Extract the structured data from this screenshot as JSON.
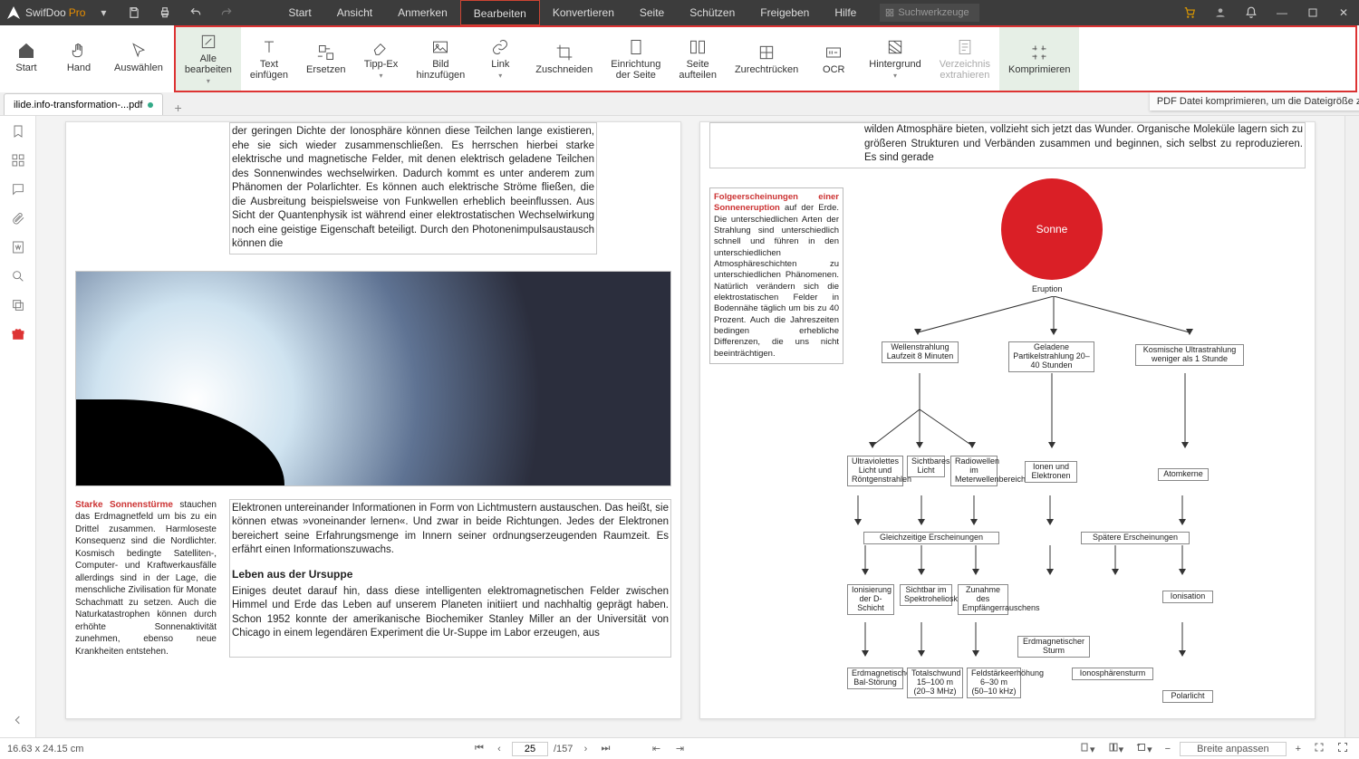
{
  "titlebar": {
    "appname": "SwifDoo",
    "pro": "Pro",
    "menus": [
      "Start",
      "Ansicht",
      "Anmerken",
      "Bearbeiten",
      "Konvertieren",
      "Seite",
      "Schützen",
      "Freigeben",
      "Hilfe"
    ],
    "active_menu_index": 3,
    "search_placeholder": "Suchwerkzeuge"
  },
  "ribbon": {
    "outside": [
      {
        "key": "start",
        "label1": "Start"
      },
      {
        "key": "hand",
        "label1": "Hand"
      },
      {
        "key": "select",
        "label1": "Auswählen"
      }
    ],
    "tools": [
      {
        "key": "editall",
        "label1": "Alle",
        "label2": "bearbeiten",
        "dd": true,
        "highlight": true
      },
      {
        "key": "inserttext",
        "label1": "Text",
        "label2": "einfügen"
      },
      {
        "key": "replace",
        "label1": "Ersetzen"
      },
      {
        "key": "tippex",
        "label1": "Tipp-Ex",
        "dd": true
      },
      {
        "key": "addimage",
        "label1": "Bild",
        "label2": "hinzufügen"
      },
      {
        "key": "link",
        "label1": "Link",
        "dd": true
      },
      {
        "key": "crop",
        "label1": "Zuschneiden"
      },
      {
        "key": "pagesetup",
        "label1": "Einrichtung",
        "label2": "der Seite"
      },
      {
        "key": "split",
        "label1": "Seite",
        "label2": "aufteilen"
      },
      {
        "key": "flatten",
        "label1": "Zurechtrücken"
      },
      {
        "key": "ocr",
        "label1": "OCR"
      },
      {
        "key": "background",
        "label1": "Hintergrund",
        "dd": true
      },
      {
        "key": "extract",
        "label1": "Verzeichnis",
        "label2": "extrahieren",
        "disabled": true
      },
      {
        "key": "compress",
        "label1": "Komprimieren",
        "highlight": true
      }
    ],
    "tooltip": "PDF Datei komprimieren, um die Dateigröße zu optimieren"
  },
  "tab": {
    "filename": "ilide.info-transformation-...pdf",
    "page_badge": "1"
  },
  "document": {
    "pageA": {
      "topText": "der geringen Dichte der Ionosphäre können diese Teilchen lange existieren, ehe sie sich wieder zusammenschließen. Es herrschen hierbei starke elektrische und magnetische Felder, mit denen elektrisch geladene Teilchen des Sonnenwindes wechselwirken. Dadurch kommt es unter anderem zum Phänomen der Polarlichter. Es können auch elektrische Ströme fließen, die die Ausbreitung beispielsweise von Funkwellen erheblich beeinflussen. Aus Sicht der Quantenphysik ist während einer elektrostatischen Wechselwirkung noch eine geistige Eigenschaft beteiligt. Durch den Photonenimpulsaustausch können die",
      "sideTitle": "Starke Sonnenstürme",
      "sideText": " stauchen das Erdmagnetfeld um bis zu ein Drittel zusammen. Harmloseste Konsequenz sind die Nordlichter. Kosmisch bedingte Satelliten-, Computer- und Kraftwerkausfälle allerdings sind in der Lage, die menschliche Zivilisation für Monate Schachmatt zu setzen. Auch die Naturkatastrophen können durch erhöhte Sonnenaktivität zunehmen, ebenso neue Krankheiten entstehen.",
      "mainPara": "Elektronen untereinander Informationen in Form von Lichtmustern austauschen. Das heißt, sie können etwas »voneinander lernen«. Und zwar in beide Richtungen. Jedes der Elektronen bereichert seine Erfahrungsmenge im Innern seiner ordnungserzeugenden Raumzeit. Es erfährt einen Informationszuwachs.",
      "mainHeading": "Leben aus der Ursuppe",
      "mainPara2": "Einiges deutet darauf hin, dass diese intelligenten elektromagnetischen Felder zwischen Himmel und Erde das Leben auf unserem Planeten initiiert und nachhaltig geprägt haben. Schon 1952 konnte der amerikanische Biochemiker Stanley Miller an der Universität von Chicago in einem legendären Experiment die Ur-Suppe im Labor erzeugen, aus"
    },
    "pageB": {
      "topText": "wilden Atmosphäre bieten, vollzieht sich jetzt das Wunder. Organische Moleküle lagern sich zu größeren Strukturen und Verbänden zusammen und beginnen, sich selbst zu reproduzieren. Es sind gerade",
      "boxTitle": "Folgeerscheinungen einer Sonneneruption",
      "boxText": " auf der Erde. Die unterschiedlichen Arten der Strahlung sind unterschiedlich schnell und führen in den unterschiedlichen Atmosphäreschichten zu unterschiedlichen Phänomenen. Natürlich verändern sich die elektrostatischen Felder in Bodennähe täglich um bis zu 40 Prozent. Auch die Jahreszeiten bedingen erhebliche Differenzen, die uns nicht beeinträchtigen.",
      "diagram": {
        "sun": "Sonne",
        "eruption": "Eruption",
        "r1a": "Wellenstrahlung Laufzeit 8 Minuten",
        "r1b": "Geladene Partikelstrahlung 20–40 Stunden",
        "r1c": "Kosmische Ultrastrahlung weniger als 1 Stunde",
        "r2a": "Ultraviolettes Licht und Röntgenstrahlen",
        "r2b": "Sichtbares Licht",
        "r2c": "Radiowellen im Meterwellenbereich",
        "r2d": "Ionen und Elektronen",
        "r2e": "Atomkerne",
        "r3a": "Gleichzeitige Erscheinungen",
        "r3b": "Spätere Erscheinungen",
        "r4a": "Ionisierung der D-Schicht",
        "r4b": "Sichtbar im Spektrohelioskop",
        "r4c": "Zunahme des Empfängerrauschens",
        "r4d": "Erdmagnetischer Sturm",
        "r4e": "Ionosphärensturm",
        "r4f": "Ionisation",
        "r5a": "Erdmagnetische Bal-Störung",
        "r5b": "Totalschwund 15–100 m (20–3 MHz)",
        "r5c": "Feldstärkeerhöhung 6–30 m (50–10 kHz)",
        "r5d": "Polarlicht"
      }
    }
  },
  "statusbar": {
    "dim": "16.63 x 24.15 cm",
    "page_current": "25",
    "page_total": "/157",
    "fit_label": "Breite anpassen"
  }
}
